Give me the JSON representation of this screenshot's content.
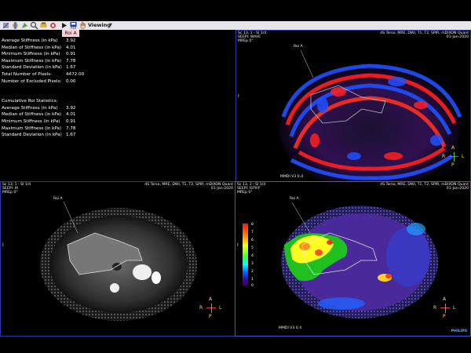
{
  "toolbar": {
    "icons": [
      "tool-icon",
      "tool-icon",
      "tool-icon",
      "tool-icon",
      "tool-icon",
      "tool-icon",
      "play-icon",
      "save-icon",
      "hand-icon"
    ],
    "save_label": "ROI",
    "viewing_label": "Viewing",
    "roi_tab": "Roi A"
  },
  "stats": {
    "rows": [
      {
        "label": "Average Stiffness (in kPa)",
        "value": "3.92"
      },
      {
        "label": "Median of Stiffness (in kPa)",
        "value": "4.01"
      },
      {
        "label": "Minimum Stiffness (in kPa)",
        "value": "0.91"
      },
      {
        "label": "Maximum Stiffness (in kPa)",
        "value": "7.78"
      },
      {
        "label": "Standard Deviation (in kPa)",
        "value": "1.67"
      },
      {
        "label": "Total Number of Pixels:",
        "value": "4472.00"
      },
      {
        "label": "Number of Excluded Pixels:",
        "value": "0.00"
      }
    ],
    "cumulative_title": "Cumulative Roi Statistics:",
    "cumulative_rows": [
      {
        "label": "Average Stiffness (in kPa)",
        "value": "3.92"
      },
      {
        "label": "Median of Stiffness (in kPa)",
        "value": "4.01"
      },
      {
        "label": "Minimum Stiffness (in kPa)",
        "value": "0.91"
      },
      {
        "label": "Maximum Stiffness (in kPa)",
        "value": "7.78"
      },
      {
        "label": "Standard Deviation (in kPa)",
        "value": "1.67"
      }
    ]
  },
  "viewports": {
    "wave": {
      "series": "Sc 13, 1 - Sl 1/4",
      "seq": "SEEPI: WAVE",
      "mre": "MREp 0°",
      "protocol": "dS Torso, MRE, DWI, T1, T2, SPIR, mDIXON Quant",
      "date": "01-Jan-2020",
      "roi": "Roi A",
      "version": "MMDI V3 0.4",
      "colors": {
        "accent": "#ff2020",
        "secondary": "#2050ff"
      }
    },
    "mag": {
      "series": "Sc 13, 1 - Sl 1/4",
      "seq": "SEEPI: M",
      "mre": "MREp 0°",
      "protocol": "dS Torso, MRE, DWI, T1, T2, SPIR, mDIXON Quant",
      "date": "01-Jan-2020",
      "roi": "Roi A"
    },
    "stiff": {
      "series": "Sc 13, 1 - Sl 1/4",
      "seq": "SEEPI: ISTIFF",
      "mre": "MREp 0°",
      "protocol": "dS Torso, MRE, DWI, T1, T2, SPIR, mDIXON Quant",
      "date": "01-Jan-2020",
      "roi": "Roi A",
      "version": "MMDI V3 0.4",
      "vendor": "PHILIPS",
      "colorbar_labels": [
        "8",
        "7",
        "6",
        "5",
        "4",
        "3",
        "2",
        "1",
        "0"
      ]
    }
  },
  "compass": {
    "a": "A",
    "p": "P",
    "r": "R",
    "l": "L"
  },
  "cursor_mark": "I"
}
